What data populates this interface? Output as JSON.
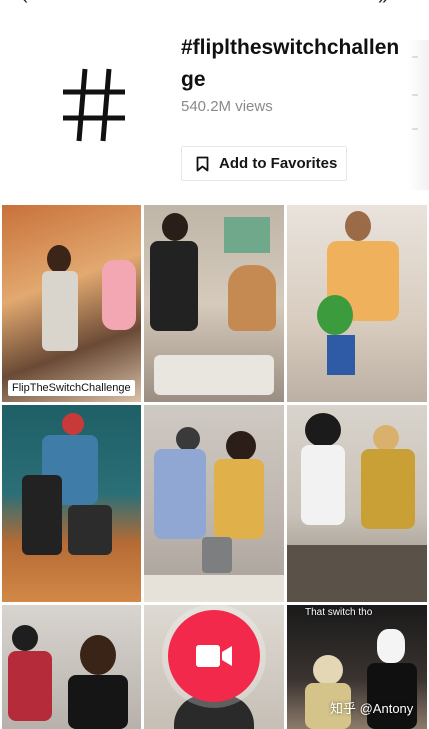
{
  "header": {
    "back_icon": "chevron-left-icon",
    "share_icon": "share-arrow-icon",
    "hashtag_icon": "hashtag-icon",
    "title": "#flipltheswitchchallenge",
    "views": "540.2M views",
    "favorite_label": "Add to Favorites",
    "favorite_icon": "bookmark-icon"
  },
  "videos": [
    {
      "overlay_label": "FlipTheSwitchChallenge"
    },
    {},
    {},
    {},
    {},
    {},
    {},
    {},
    {
      "caption": "That switch tho"
    }
  ],
  "record_button": {
    "icon": "video-camera-icon",
    "color": "#f2294b"
  },
  "watermark": "知乎 @Antony"
}
